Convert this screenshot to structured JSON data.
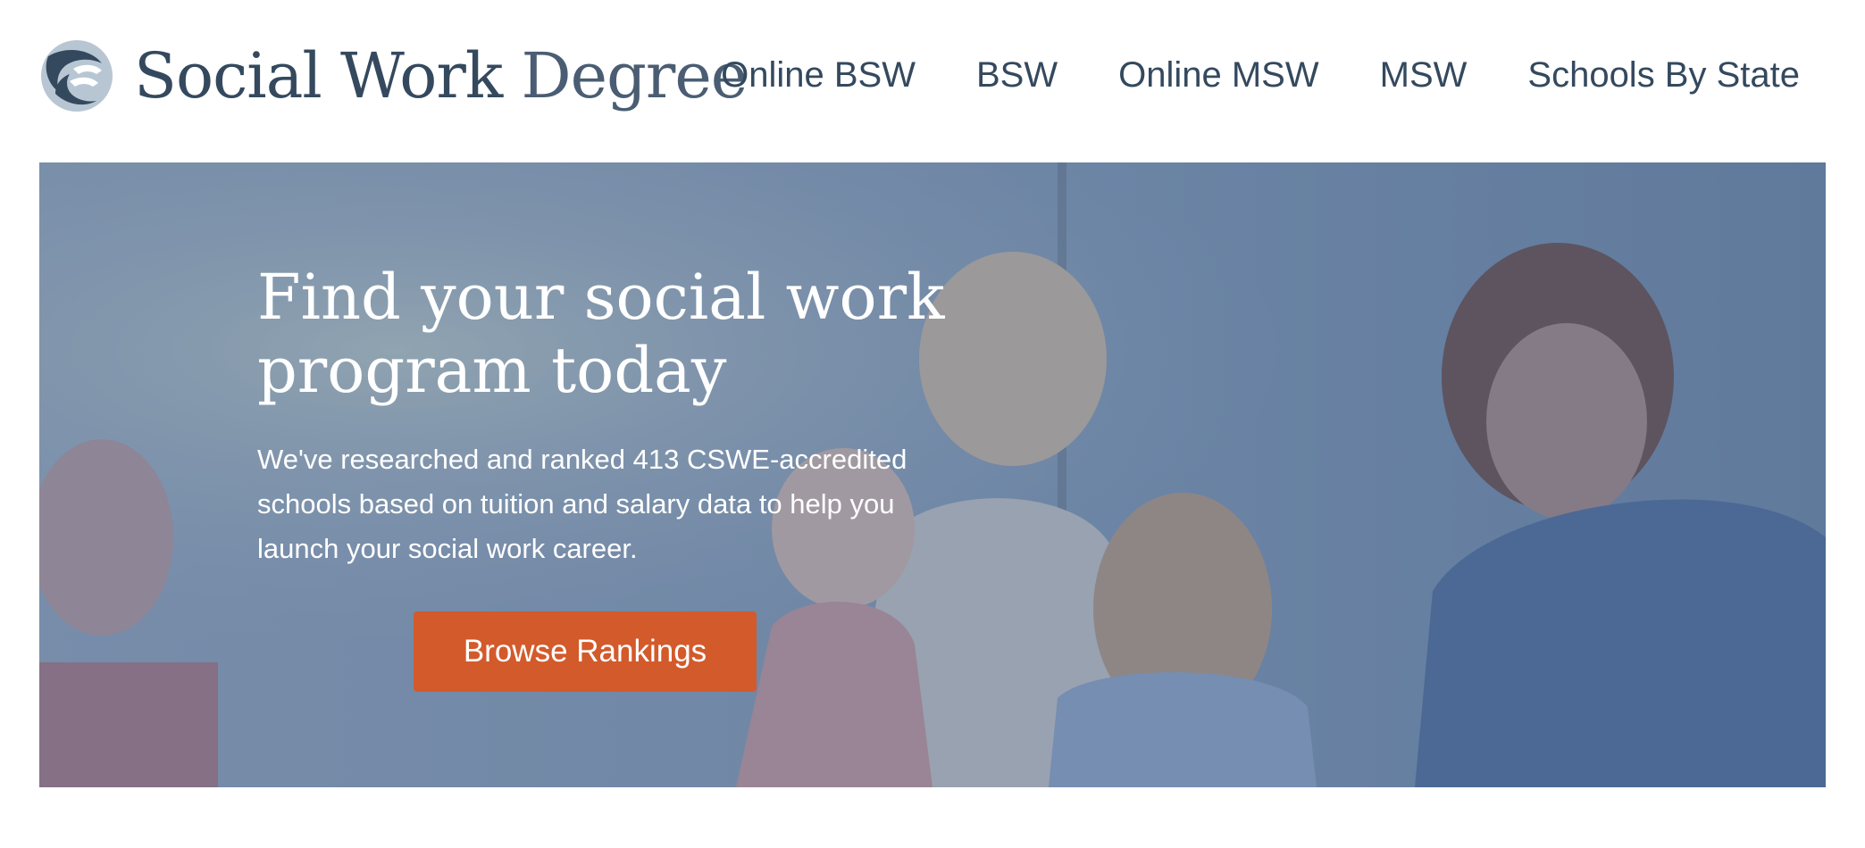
{
  "header": {
    "logo": {
      "name_bold": "Social Work",
      "name_light": "Degree"
    },
    "nav": [
      {
        "label": "Online BSW"
      },
      {
        "label": "BSW"
      },
      {
        "label": "Online MSW"
      },
      {
        "label": "MSW"
      },
      {
        "label": "Schools By State"
      }
    ]
  },
  "hero": {
    "title_line1": "Find your social work",
    "title_line2": "program today",
    "description": "We've researched and ranked 413 CSWE-accredited schools based on tuition and salary data to help you launch your social work career.",
    "cta_label": "Browse Rankings"
  },
  "colors": {
    "brand_text": "#34495e",
    "cta": "#d35a2b",
    "hero_overlay": "#6f89a8"
  },
  "icons": [
    "social-work-hands-logo-icon"
  ]
}
